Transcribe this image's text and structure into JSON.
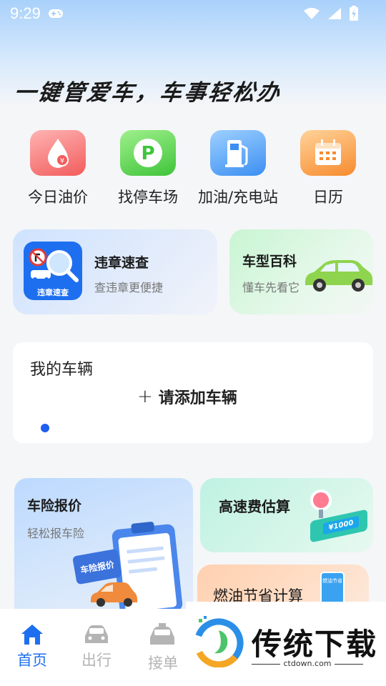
{
  "status_bar": {
    "time": "9:29"
  },
  "headline": "一键管爱车，车事轻松办",
  "quick_actions": [
    {
      "label": "今日油价",
      "icon": "oil-price-icon"
    },
    {
      "label": "找停车场",
      "icon": "parking-icon"
    },
    {
      "label": "加油/充电站",
      "icon": "fuel-station-icon"
    },
    {
      "label": "日历",
      "icon": "calendar-icon"
    }
  ],
  "violation_card": {
    "title": "违章速查",
    "subtitle": "查违章更便捷",
    "icon_caption": "违章速查"
  },
  "car_wiki_card": {
    "title": "车型百科",
    "subtitle": "懂车先看它"
  },
  "vehicle_section": {
    "title": "我的车辆",
    "add_label": "请添加车辆",
    "add_symbol": "+"
  },
  "insurance_card": {
    "title": "车险报价",
    "subtitle": "轻松报车险",
    "clipboard_label": "车险报价"
  },
  "toll_card": {
    "title": "高速费估算",
    "ticket_text": "¥1000"
  },
  "fuel_card": {
    "title": "燃油节省计算",
    "badge_text": "燃油节省"
  },
  "tabbar": {
    "items": [
      {
        "label": "首页",
        "icon": "home-icon",
        "active": true
      },
      {
        "label": "出行",
        "icon": "car-icon",
        "active": false
      },
      {
        "label": "接单",
        "icon": "taxi-icon",
        "active": false
      }
    ]
  },
  "watermark": {
    "brand": "传统下载",
    "url": "ctdown.com"
  },
  "colors": {
    "accent": "#1e6ff0",
    "inactive": "#b4b4b4"
  }
}
